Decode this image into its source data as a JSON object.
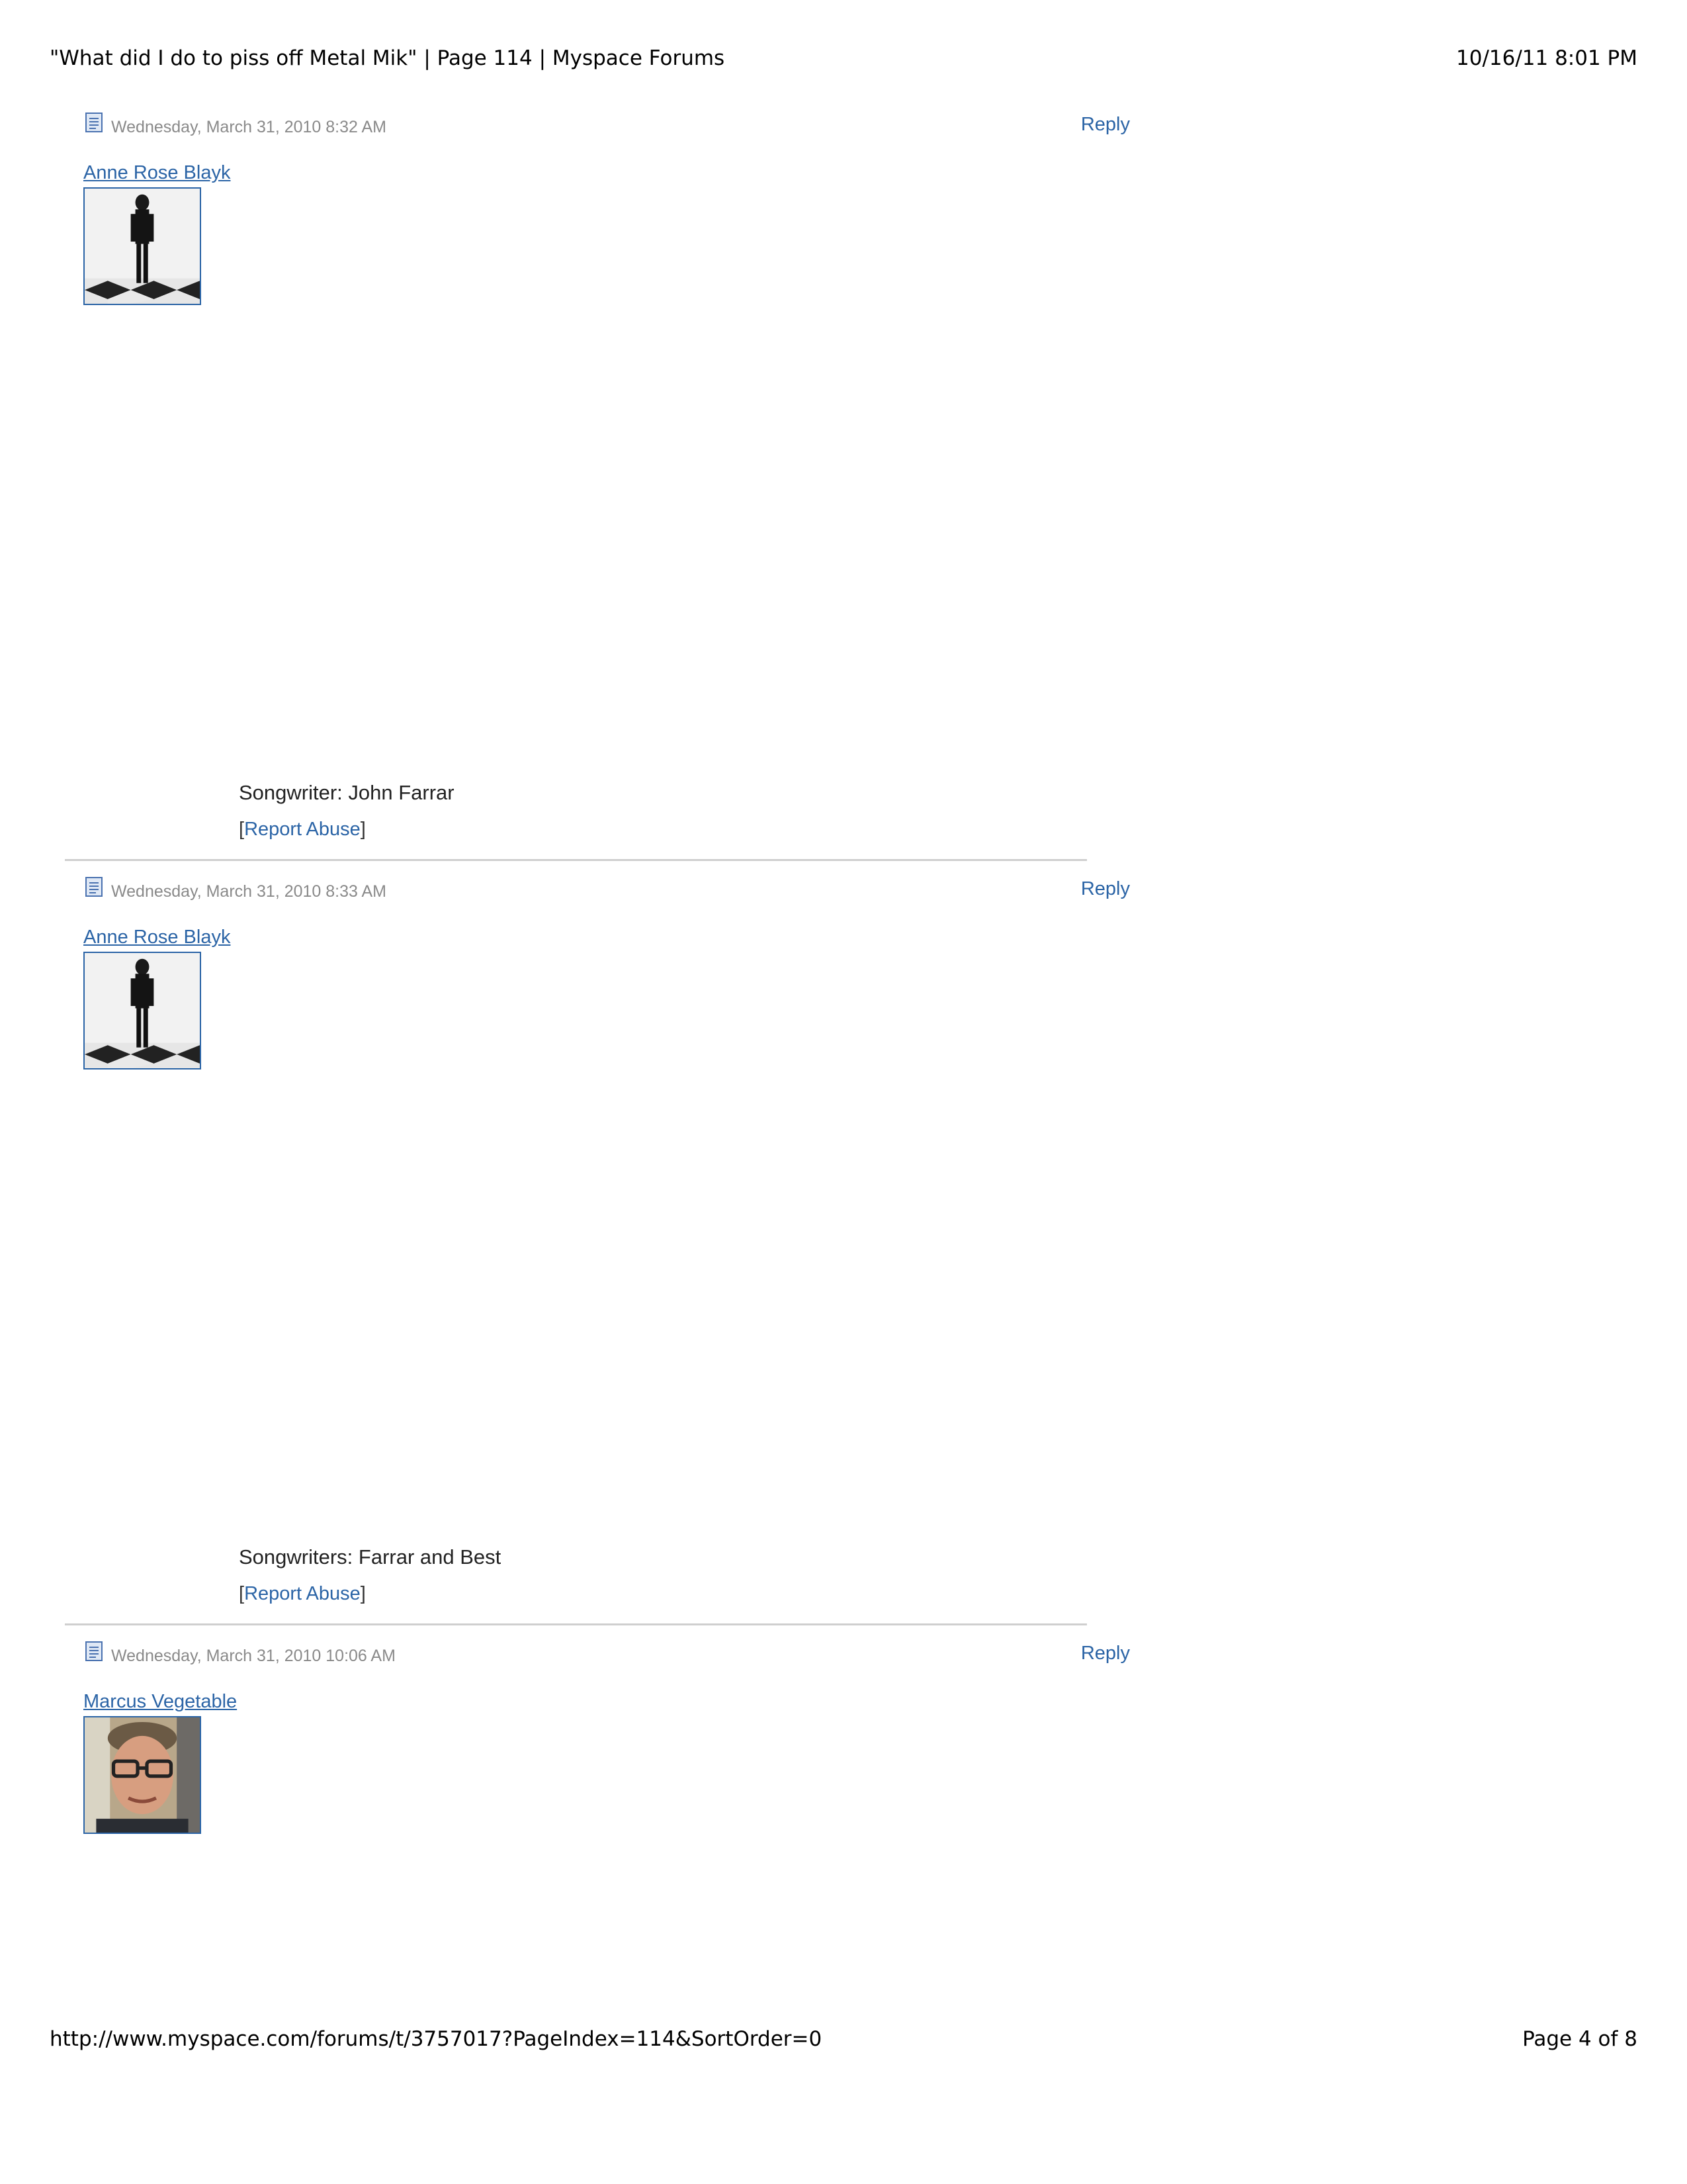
{
  "print_header": {
    "title": "\"What did I do to piss off Metal Mik\" | Page 114 | Myspace Forums",
    "datetime": "10/16/11 8:01 PM"
  },
  "print_footer": {
    "url": "http://www.myspace.com/forums/t/3757017?PageIndex=114&SortOrder=0",
    "page_label": "Page 4 of 8"
  },
  "posts": [
    {
      "timestamp": "Wednesday, March 31, 2010 8:32 AM",
      "reply_label": "Reply",
      "author": "Anne Rose Blayk",
      "avatar_icon": "avatar-photo-woman-in-black",
      "body": "Songwriter: John Farrar",
      "report_label": "Report Abuse"
    },
    {
      "timestamp": "Wednesday, March 31, 2010 8:33 AM",
      "reply_label": "Reply",
      "author": "Anne Rose Blayk",
      "avatar_icon": "avatar-photo-woman-in-black",
      "body": "Songwriters: Farrar and Best",
      "report_label": "Report Abuse"
    },
    {
      "timestamp": "Wednesday, March 31, 2010 10:06 AM",
      "reply_label": "Reply",
      "author": "Marcus Vegetable",
      "avatar_icon": "avatar-photo-man-with-glasses"
    }
  ],
  "colors": {
    "link": "#2b64a6",
    "timestamp": "#8a8a8a",
    "divider": "#cfcfcf"
  }
}
